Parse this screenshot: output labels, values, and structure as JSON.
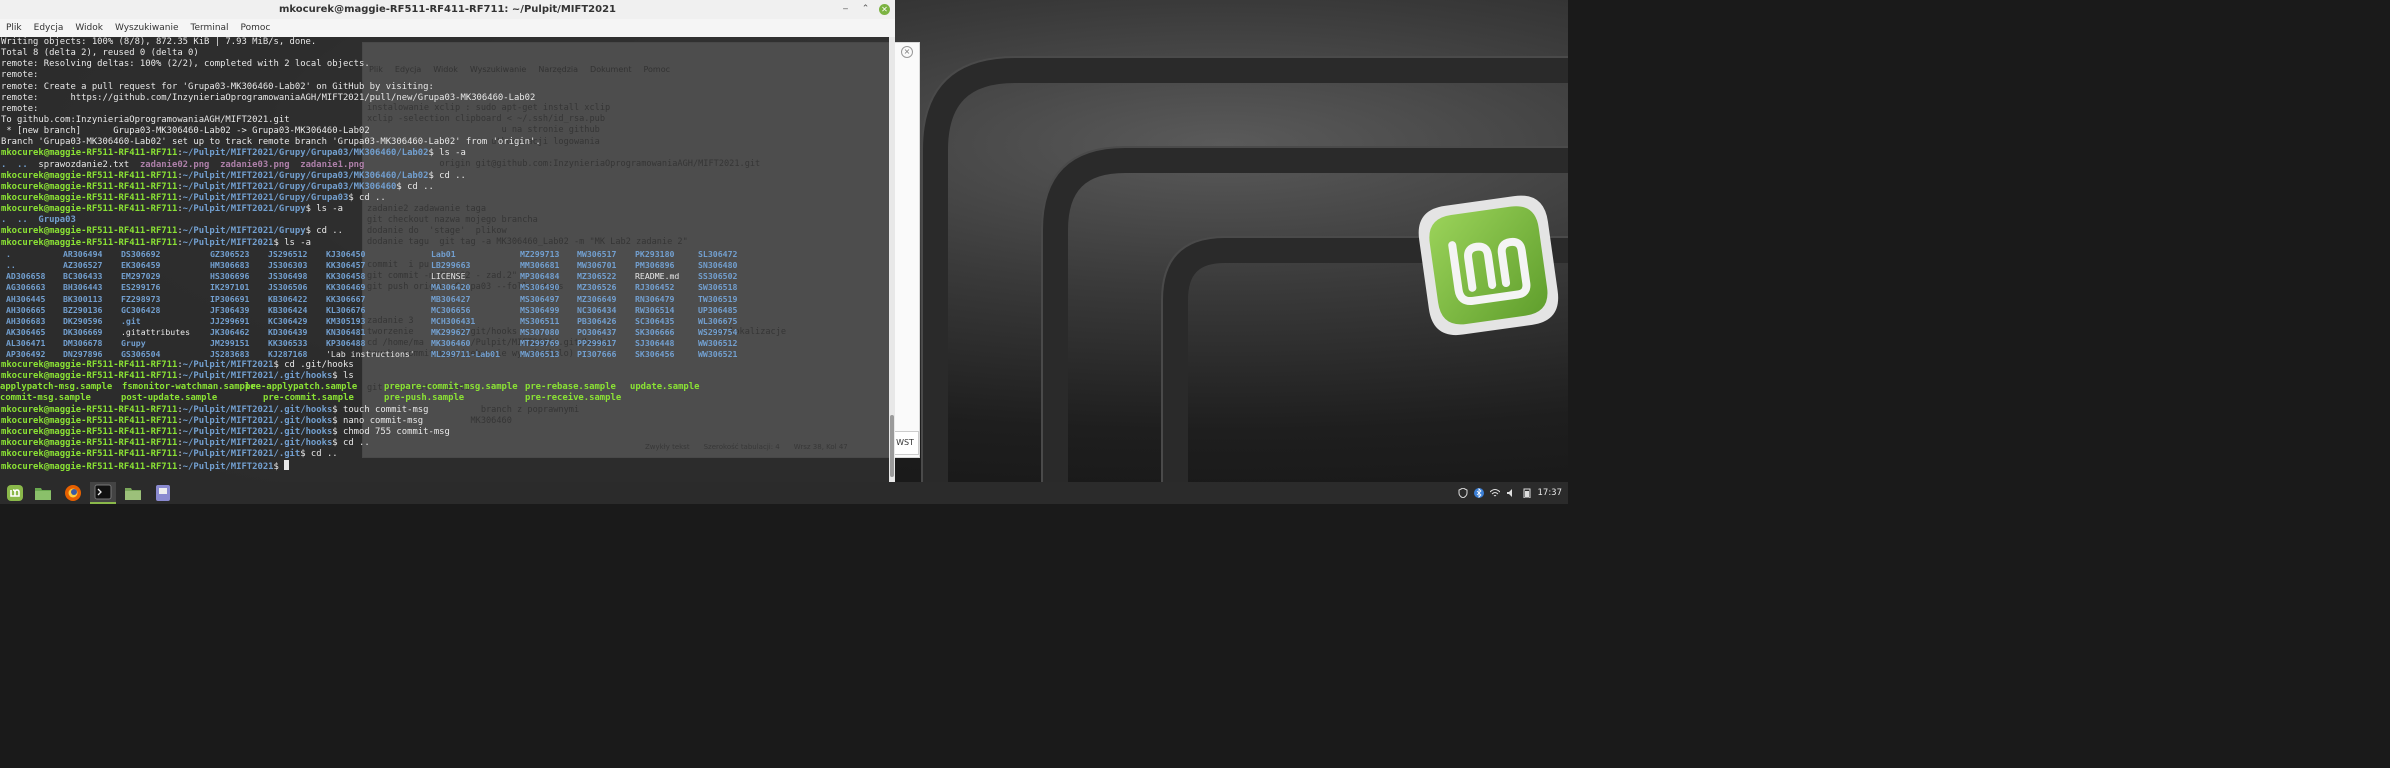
{
  "terminal": {
    "title": "mkocurek@maggie-RF511-RF411-RF711: ~/Pulpit/MIFT2021",
    "menu": [
      "Plik",
      "Edycja",
      "Widok",
      "Wyszukiwanie",
      "Terminal",
      "Pomoc"
    ],
    "prompt_user": "mkocurek@maggie-RF511-RF411-RF711",
    "lines": [
      {
        "kind": "out",
        "text": "Writing objects: 100% (8/8), 872.35 KiB | 7.93 MiB/s, done."
      },
      {
        "kind": "out",
        "text": "Total 8 (delta 2), reused 0 (delta 0)"
      },
      {
        "kind": "out",
        "text": "remote: Resolving deltas: 100% (2/2), completed with 2 local objects."
      },
      {
        "kind": "out",
        "text": "remote:"
      },
      {
        "kind": "out",
        "text": "remote: Create a pull request for 'Grupa03-MK306460-Lab02' on GitHub by visiting:"
      },
      {
        "kind": "out",
        "text": "remote:      https://github.com/InzynieriaOprogramowaniaAGH/MIFT2021/pull/new/Grupa03-MK306460-Lab02"
      },
      {
        "kind": "out",
        "text": "remote:"
      },
      {
        "kind": "out",
        "text": "To github.com:InzynieriaOprogramowaniaAGH/MIFT2021.git"
      },
      {
        "kind": "out",
        "text": " * [new branch]      Grupa03-MK306460-Lab02 -> Grupa03-MK306460-Lab02"
      },
      {
        "kind": "out",
        "text": "Branch 'Grupa03-MK306460-Lab02' set up to track remote branch 'Grupa03-MK306460-Lab02' from 'origin'."
      },
      {
        "kind": "cmd",
        "path": "~/Pulpit/MIFT2021/Grupy/Grupa03/MK306460/Lab02",
        "cmd": "ls -a"
      }
    ],
    "ls_lab02": [
      ".",
      "..",
      "sprawozdanie2.txt",
      "zadanie02.png",
      "zadanie03.png",
      "zadanie1.png"
    ],
    "lines2": [
      {
        "kind": "cmd",
        "path": "~/Pulpit/MIFT2021/Grupy/Grupa03/MK306460/Lab02",
        "cmd": "cd .."
      },
      {
        "kind": "cmd",
        "path": "~/Pulpit/MIFT2021/Grupy/Grupa03/MK306460",
        "cmd": "cd .."
      },
      {
        "kind": "cmd",
        "path": "~/Pulpit/MIFT2021/Grupy/Grupa03",
        "cmd": "cd .."
      },
      {
        "kind": "cmd",
        "path": "~/Pulpit/MIFT2021/Grupy",
        "cmd": "ls -a"
      }
    ],
    "ls_grupy": [
      ".",
      "..",
      "Grupa03"
    ],
    "lines3": [
      {
        "kind": "cmd",
        "path": "~/Pulpit/MIFT2021/Grupy",
        "cmd": "cd .."
      },
      {
        "kind": "cmd",
        "path": "~/Pulpit/MIFT2021",
        "cmd": "ls -a"
      }
    ],
    "ls_root": [
      [
        ".",
        "AR306494",
        "DS306692",
        "GZ306523",
        "JS296512",
        "KJ306450",
        "Lab01",
        "MZ299713",
        "MW306517",
        "PK293180",
        "SL306472"
      ],
      [
        "..",
        "AZ306527",
        "EK306459",
        "HM306683",
        "JS306303",
        "KK306457",
        "LB299663",
        "MM306681",
        "MW306701",
        "PM306896",
        "SN306480"
      ],
      [
        "AD306658",
        "BC306433",
        "EM297029",
        "HS306696",
        "JS306498",
        "KK306458",
        "LICENSE",
        "MP306484",
        "MZ306522",
        "README.md",
        "SS306502"
      ],
      [
        "AG306663",
        "BH306443",
        "ES299176",
        "IK297101",
        "JS306506",
        "KK306469",
        "MA306420",
        "MS306490",
        "MZ306526",
        "RJ306452",
        "SW306518"
      ],
      [
        "AH306445",
        "BK300113",
        "FZ298973",
        "IP306691",
        "KB306422",
        "KK306667",
        "MB306427",
        "MS306497",
        "MZ306649",
        "RN306479",
        "TW306519"
      ],
      [
        "AH306665",
        "BZ290136",
        "GC306428",
        "JF306439",
        "KB306424",
        "KL306676",
        "MC306656",
        "MS306499",
        "NC306434",
        "RW306514",
        "UP306485"
      ],
      [
        "AH306683",
        "DK290596",
        ".git",
        "JJ299691",
        "KC306429",
        "KM305193",
        "MCH306431",
        "MS306511",
        "PB306426",
        "SC306435",
        "WL306675"
      ],
      [
        "AK306465",
        "DK306669",
        ".gitattributes",
        "JK306462",
        "KD306439",
        "KN306481",
        "MK299627",
        "MS307080",
        "PO306437",
        "SK306666",
        "WS299754"
      ],
      [
        "AL306471",
        "DM306678",
        "Grupy",
        "JM299151",
        "KK306533",
        "KP306488",
        "MK306460",
        "MT299769",
        "PP299617",
        "SJ306448",
        "WW306512"
      ],
      [
        "AP306492",
        "DN297896",
        "GS306504",
        "JS283683",
        "KJ287168",
        "'Lab instructions'",
        "ML299711-Lab01",
        "MW306513",
        "PI307666",
        "SK306456",
        "WW306521"
      ]
    ],
    "lines4": [
      {
        "kind": "cmd",
        "path": "~/Pulpit/MIFT2021",
        "cmd": "cd .git/hooks"
      },
      {
        "kind": "cmd",
        "path": "~/Pulpit/MIFT2021/.git/hooks",
        "cmd": "ls"
      }
    ],
    "ls_hooks": [
      [
        "applypatch-msg.sample",
        "fsmonitor-watchman.sample",
        "post-update.sample",
        "pre-applypatch.sample",
        "prepare-commit-msg.sample",
        "pre-rebase.sample",
        "update.sample"
      ],
      [
        "commit-msg.sample",
        "post-update.sample",
        "pre-commit.sample",
        "pre-push.sample",
        "pre-receive.sample"
      ]
    ],
    "lines5": [
      {
        "kind": "cmd",
        "path": "~/Pulpit/MIFT2021/.git/hooks",
        "cmd": "touch commit-msg"
      },
      {
        "kind": "cmd",
        "path": "~/Pulpit/MIFT2021/.git/hooks",
        "cmd": "nano commit-msg"
      },
      {
        "kind": "cmd",
        "path": "~/Pulpit/MIFT2021/.git/hooks",
        "cmd": "chmod 755 commit-msg"
      },
      {
        "kind": "cmd",
        "path": "~/Pulpit/MIFT2021/.git/hooks",
        "cmd": "cd .."
      },
      {
        "kind": "cmd",
        "path": "~/Pulpit/MIFT2021/.git",
        "cmd": "cd .."
      },
      {
        "kind": "cmd",
        "path": "~/Pulpit/MIFT2021",
        "cmd": ""
      }
    ]
  },
  "editor": {
    "menu": [
      "Plik",
      "Edycja",
      "Widok",
      "Wyszukiwanie",
      "Narzędzia",
      "Dokument",
      "Pomoc"
    ],
    "lines": [
      "instalowanie xclip : sudo apt-get install xclip",
      "xclip -selection clipboard < ~/.ssh/id_rsa.pub",
      "                          u na stronie github",
      "                        uthoryzacji logowania",
      "",
      "              origin git@github.com:InzynieriaOprogramowaniaAGH/MIFT2021.git",
      "",
      "",
      "",
      "zadanie2 zadawanie taga",
      "git checkout nazwa mojego brancha",
      "dodanie do  'stage'  plikow",
      "dodanie tagu  git tag -a MK306460_Lab02 -m \"MK Lab2 zadanie 2\"",
      "",
      "commit  i pu",
      "git commit -m \"Lab02 - zad.2\"",
      "git push origin  Grupa03 --follow-tags",
      "",
      "",
      "zadanie 3",
      "tworzenie         /.git/hooks                                      na lokalizacje",
      "cd /home/ma         /Pulpit/MIFT2021/.git/hooks",
      "touch  commit-msg (zeby sie wyswietlalo)",
      "",
      "",
      "git checkout Grupa03",
      "",
      "                      branch z poprawnymi",
      "                    MK306460"
    ],
    "status": [
      "Zwykły tekst",
      "Szerokość tabulacji: 4",
      "Wrsz 38, Kol 47"
    ],
    "wst": "WST"
  },
  "taskbar": {
    "clock": "17:37",
    "apps": [
      "mint-menu-icon",
      "files-icon",
      "firefox-icon",
      "terminal-icon",
      "folder-icon",
      "text-editor-icon"
    ]
  }
}
